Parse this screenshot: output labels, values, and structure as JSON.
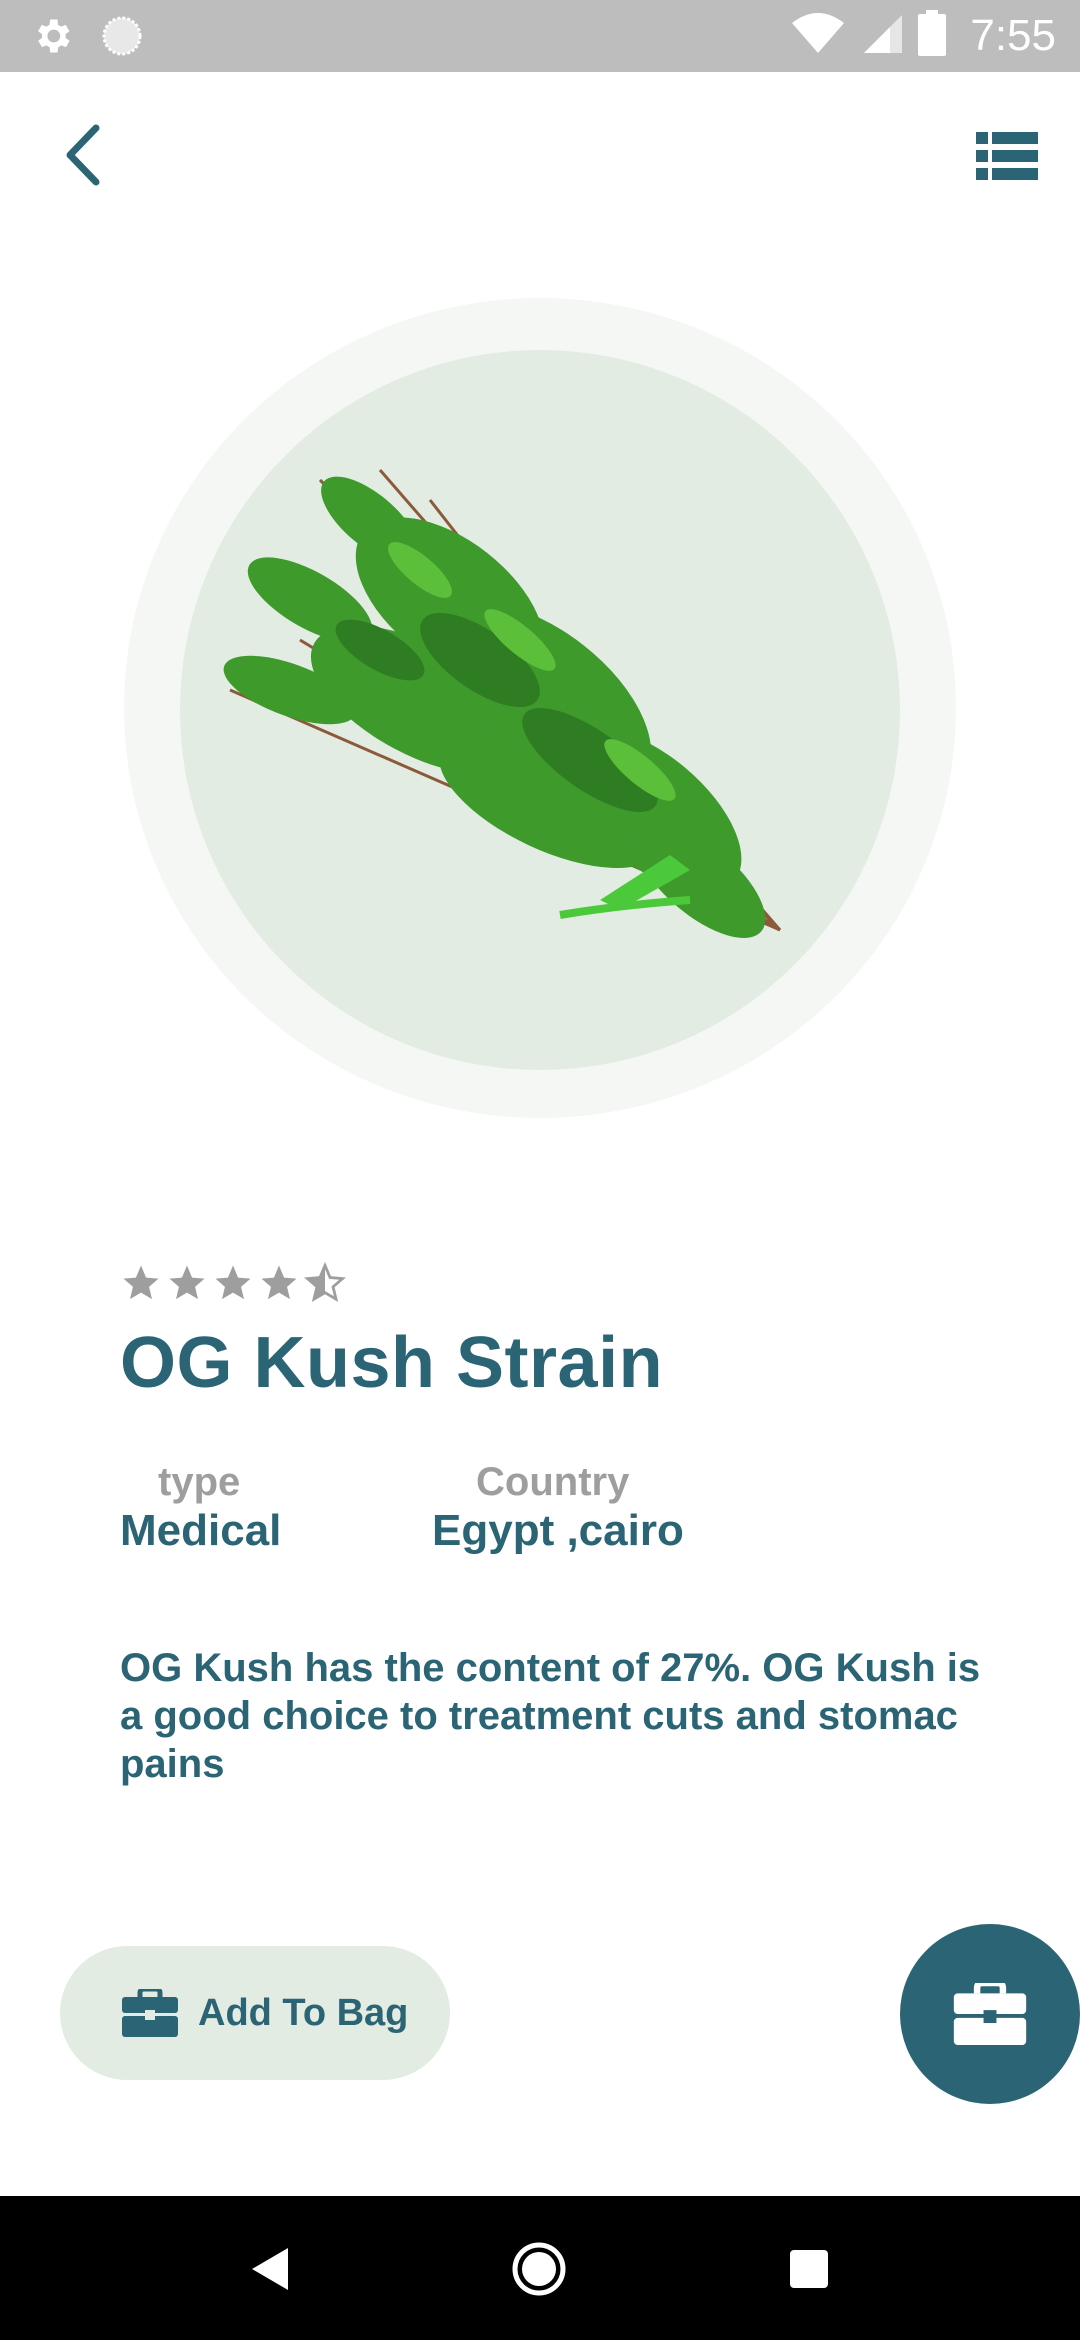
{
  "status_bar": {
    "time": "7:55",
    "icons": [
      "settings-gear-icon",
      "sync-circle-icon",
      "wifi-icon",
      "cell-signal-icon",
      "battery-icon"
    ]
  },
  "app_bar": {
    "back_icon": "chevron-left-icon",
    "menu_icon": "list-view-icon"
  },
  "product": {
    "image_alt": "herb bundle",
    "rating": 4.5,
    "rating_max": 5,
    "name": "OG Kush Strain",
    "type_label": "type",
    "type_value": "Medical",
    "country_label": "Country",
    "country_value": "Egypt ,cairo",
    "description": "OG Kush has the content of 27%. OG Kush is a good choice to treatment cuts and stomac pains"
  },
  "actions": {
    "add_to_bag_label": "Add To Bag",
    "add_to_bag_icon": "briefcase-icon",
    "fab_icon": "briefcase-icon"
  },
  "nav_bar": {
    "items": [
      "back-triangle-icon",
      "home-circle-icon",
      "recents-square-icon"
    ]
  },
  "colors": {
    "primary": "#2b6474",
    "muted": "#9e9e9e",
    "image_bg_inner": "#e2ece2",
    "image_bg_outer": "#f4f7f4",
    "button_bg": "#e2ece2",
    "status_bar": "#bdbdbd"
  }
}
